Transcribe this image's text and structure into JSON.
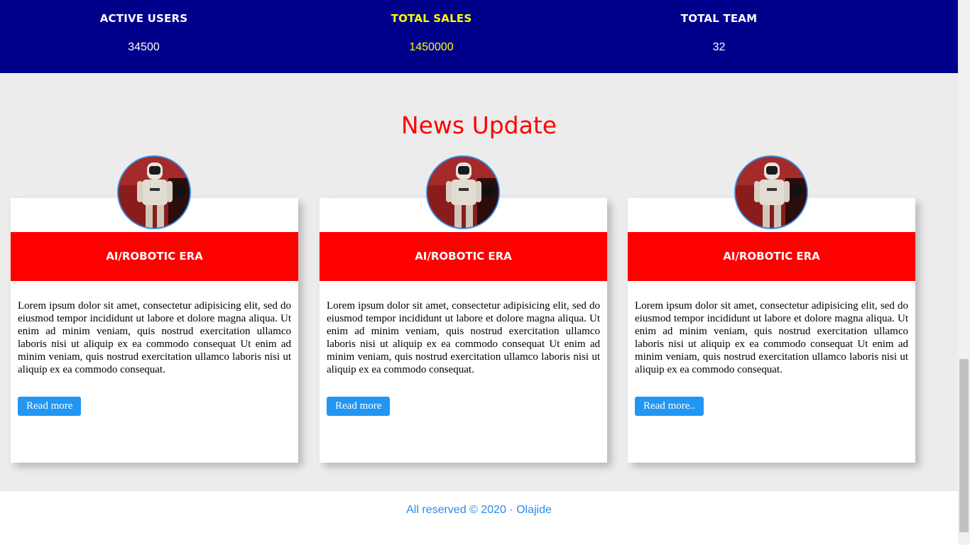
{
  "stats": [
    {
      "label": "ACTIVE USERS",
      "value": "34500",
      "color": "#ffffff"
    },
    {
      "label": "TOTAL SALES",
      "value": "1450000",
      "color": "#ffff00"
    },
    {
      "label": "TOTAL TEAM",
      "value": "32",
      "color": "#ffffff"
    }
  ],
  "news": {
    "title": "News Update",
    "cards": [
      {
        "heading": "AI/ROBOTIC ERA",
        "body": "Lorem ipsum dolor sit amet, consectetur adipisicing elit, sed do eiusmod tempor incididunt ut labore et dolore magna aliqua. Ut enim ad minim veniam, quis nostrud exercitation ullamco laboris nisi ut aliquip ex ea commodo consequat Ut enim ad minim veniam, quis nostrud exercitation ullamco laboris nisi ut aliquip ex ea commodo consequat.",
        "button": "Read more"
      },
      {
        "heading": "AI/ROBOTIC ERA",
        "body": "Lorem ipsum dolor sit amet, consectetur adipisicing elit, sed do eiusmod tempor incididunt ut labore et dolore magna aliqua. Ut enim ad minim veniam, quis nostrud exercitation ullamco laboris nisi ut aliquip ex ea commodo consequat Ut enim ad minim veniam, quis nostrud exercitation ullamco laboris nisi ut aliquip ex ea commodo consequat.",
        "button": "Read more"
      },
      {
        "heading": "AI/ROBOTIC ERA",
        "body": "Lorem ipsum dolor sit amet, consectetur adipisicing elit, sed do eiusmod tempor incididunt ut labore et dolore magna aliqua. Ut enim ad minim veniam, quis nostrud exercitation ullamco laboris nisi ut aliquip ex ea commodo consequat Ut enim ad minim veniam, quis nostrud exercitation ullamco laboris nisi ut aliquip ex ea commodo consequat.",
        "button": "Read more.."
      }
    ]
  },
  "footer": {
    "text": "All reserved © 2020 · Olajide"
  },
  "colors": {
    "header_bg": "#00008b",
    "accent_red": "#ff0000",
    "button_blue": "#2196f3",
    "footer_text": "#2e8ae6"
  }
}
